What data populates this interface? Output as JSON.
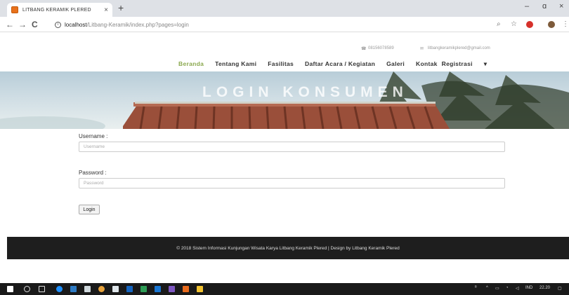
{
  "browser": {
    "tab_title": "LITBANG KERAMIK PLERED",
    "tab_close": "×",
    "new_tab": "+",
    "minimize": "–",
    "restore": "ɑ",
    "close": "×",
    "back": "←",
    "forward": "→",
    "reload": "C",
    "info": "i",
    "url_host": "localhost",
    "url_path": "/Litbang-Keramik/index.php?pages=login",
    "zoom_icon": "⌕",
    "star_icon": "☆"
  },
  "contact": {
    "phone": "08156078589",
    "email": "litbangkeramikplered@gmail.com"
  },
  "nav": {
    "beranda": "Beranda",
    "tentang": "Tentang Kami",
    "fasilitas": "Fasilitas",
    "acara": "Daftar Acara / Kegiatan",
    "galeri": "Galeri",
    "kontak": "Kontak",
    "registrasi": "Registrasi",
    "caret": "▾"
  },
  "hero": {
    "title": "LOGIN KONSUMEN"
  },
  "form": {
    "username_label": "Username :",
    "username_placeholder": "Username",
    "password_label": "Password :",
    "password_placeholder": "Password",
    "login_button": "Login"
  },
  "footer": {
    "text": "© 2018 Sistem Informasi Kunjungan Wisata Karya Litbang Keramik Plered | Design by Litbang Keramik Plered"
  },
  "taskbar": {
    "lang": "IND",
    "time": "22.20"
  },
  "colors": {
    "accent": "#8aa84e",
    "footer_bg": "#1e1e1e"
  }
}
